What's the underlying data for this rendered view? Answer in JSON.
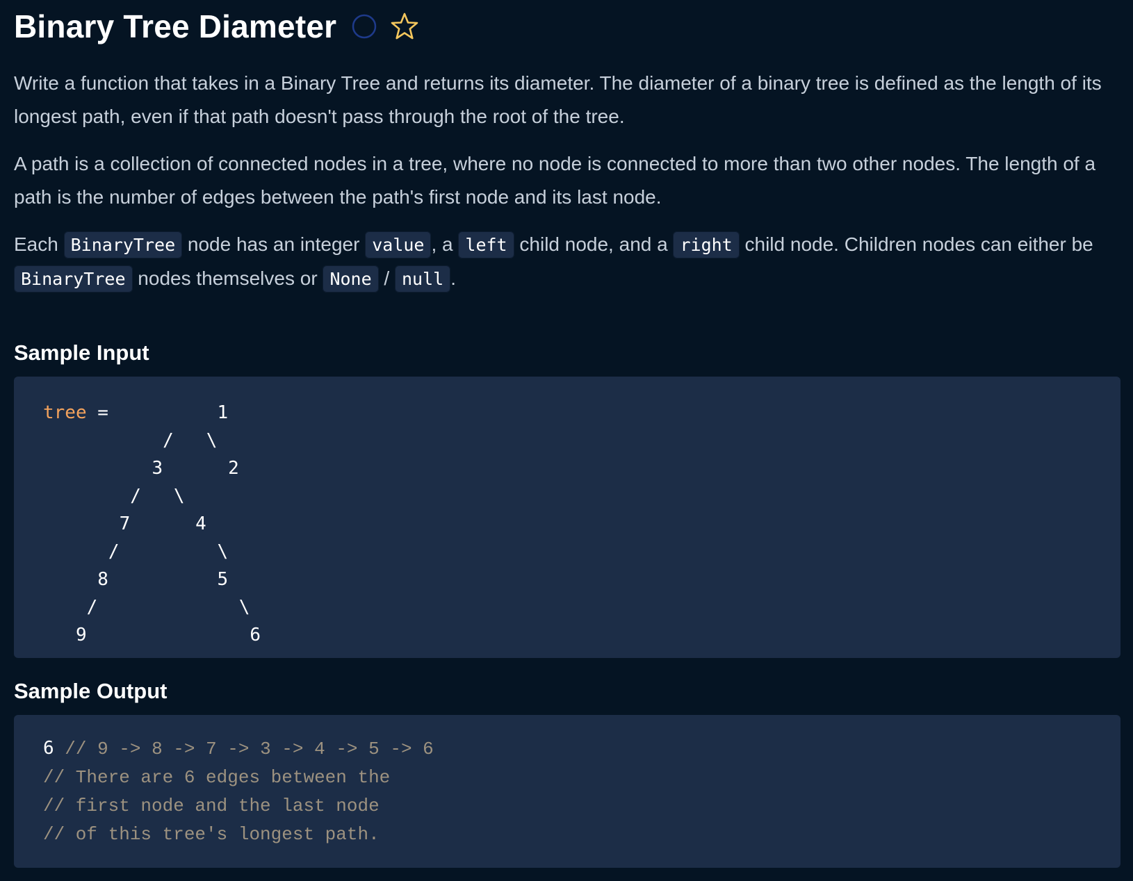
{
  "header": {
    "title": "Binary Tree Diameter",
    "status_icon": "circle-outline-icon",
    "favorite_icon": "star-outline-icon",
    "colors": {
      "status_ring": "#1e3a8a",
      "star": "#f5c75d"
    }
  },
  "description": {
    "p1": "Write a function that takes in a Binary Tree and returns its diameter. The diameter of a binary tree is defined as the length of its longest path, even if that path doesn't pass through the root of the tree.",
    "p2": "A path is a collection of connected nodes in a tree, where no node is connected to more than two other nodes. The length of a path is the number of edges between the path's first node and its last node.",
    "p3": {
      "t1": "Each ",
      "c1": "BinaryTree",
      "t2": " node has an integer ",
      "c2": "value",
      "t3": ", a ",
      "c3": "left",
      "t4": " child node, and a ",
      "c4": "right",
      "t5": " child node. Children nodes can either be ",
      "c5": "BinaryTree",
      "t6": " nodes themselves or ",
      "c6": "None",
      "t7": " / ",
      "c7": "null",
      "t8": "."
    }
  },
  "sample_input": {
    "heading": "Sample Input",
    "var_name": "tree",
    "assign": " = ",
    "tree_lines": [
      "        1",
      "      /   \\",
      "     3      2",
      "   /   \\",
      "  7      4",
      " /        \\",
      "8          5",
      "/            \\",
      "9              6"
    ],
    "tree_text": "         1\n           /   \\\n          3      2\n        /   \\\n       7      4\n      /         \\\n     8          5\n    /             \\\n   9               6"
  },
  "sample_output": {
    "heading": "Sample Output",
    "value": "6",
    "line1_comment": " // 9 -> 8 -> 7 -> 3 -> 4 -> 5 -> 6",
    "line2": "// There are 6 edges between the",
    "line3": "// first node and the last node",
    "line4": "// of this tree's longest path."
  },
  "colors": {
    "background": "#051423",
    "code_bg": "#1c2d47",
    "text": "#c7d0db",
    "heading": "#ffffff",
    "variable": "#f4a35d",
    "comment": "#9d9280"
  }
}
